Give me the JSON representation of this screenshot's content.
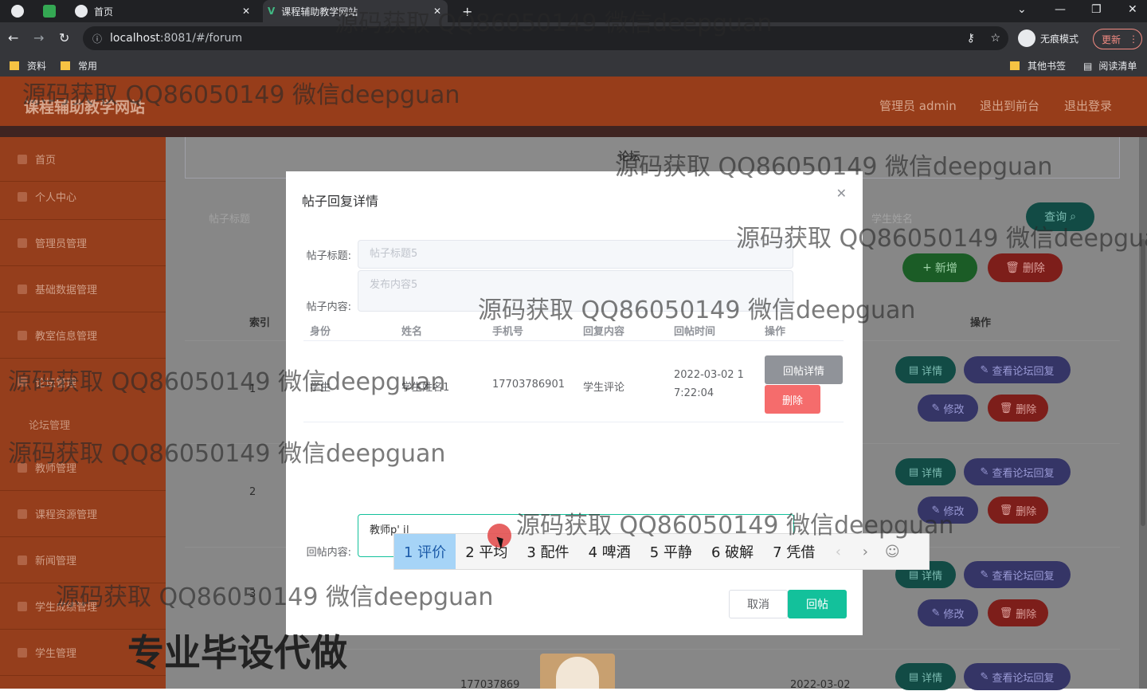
{
  "browser": {
    "tabs": [
      {
        "label": "首页"
      },
      {
        "label": "课程辅助教学网站"
      }
    ],
    "new_tab_icon": "+",
    "url_host": "localhost",
    "url_rest": ":8081/#/forum",
    "incognito_label": "无痕模式",
    "update_label": "更新",
    "bookmarks": [
      "资料",
      "常用"
    ],
    "other_bookmarks": "其他书签",
    "reading_list": "阅读清单"
  },
  "header": {
    "title": "课程辅助教学网站",
    "admin": "管理员 admin",
    "back_front": "退出到前台",
    "logout": "退出登录"
  },
  "sidebar": {
    "items": [
      {
        "label": "首页"
      },
      {
        "label": "个人中心"
      },
      {
        "label": "管理员管理"
      },
      {
        "label": "基础数据管理"
      },
      {
        "label": "教室信息管理"
      },
      {
        "label": "论坛管理"
      },
      {
        "label": "教师管理"
      },
      {
        "label": "课程资源管理"
      },
      {
        "label": "新闻管理"
      },
      {
        "label": "学生成绩管理"
      },
      {
        "label": "学生管理"
      }
    ],
    "sub_forum": "论坛管理"
  },
  "page": {
    "card_title": "论坛",
    "search_title_placeholder": "帖子标题",
    "search_student_placeholder": "学生姓名",
    "query_btn": "查询",
    "add_btn": "新增",
    "delete_btn": "删除",
    "col_index": "索引",
    "col_action": "操作",
    "row_indexes": [
      "1",
      "2",
      "3"
    ],
    "row_phone_partial": "177037869",
    "row_date_partial": "2022-03-02",
    "row_btn_detail": "详情",
    "row_btn_view_reply": "查看论坛回复",
    "row_btn_edit": "修改",
    "row_btn_delete": "删除"
  },
  "modal": {
    "title": "帖子回复详情",
    "label_title": "帖子标题:",
    "value_title": "帖子标题5",
    "label_content": "帖子内容:",
    "value_content": "发布内容5",
    "columns": [
      "身份",
      "姓名",
      "手机号",
      "回复内容",
      "回帖时间",
      "操作"
    ],
    "rows": [
      {
        "identity": "学生",
        "name": "学生姓名1",
        "phone": "17703786901",
        "reply": "学生评论",
        "time_line1": "2022-03-02 1",
        "time_line2": "7:22:04",
        "btn_detail": "回帖详情",
        "btn_delete": "删除"
      }
    ],
    "label_reply": "回帖内容:",
    "reply_value": "教师p' j|",
    "cancel": "取消",
    "submit": "回帖"
  },
  "ime": {
    "candidates": [
      "1 评价",
      "2 平均",
      "3 配件",
      "4 啤酒",
      "5 平静",
      "6 破解",
      "7 凭借"
    ]
  },
  "watermarks": [
    "源码获取 QQ86050149 微信deepguan",
    "源码获取 QQ86050149 微信deepguan",
    "源码获取 QQ86050149 微信deepguan",
    "源码获取 QQ86050149 微信deepgua",
    "源码获取 QQ86050149 微信deepguan",
    "源码获取 QQ86050149 微信deepguan",
    "源码获取 QQ86050149 微信deepguan",
    "源码获取 QQ86050149 微信deepguan",
    "源码获取 QQ86050149 微信deepguan"
  ],
  "promo": "专业毕设代做",
  "colors": {
    "header": "#973d1a",
    "sidebar": "#953e1c",
    "accent": "#13c19b",
    "danger": "#f56c6c"
  }
}
